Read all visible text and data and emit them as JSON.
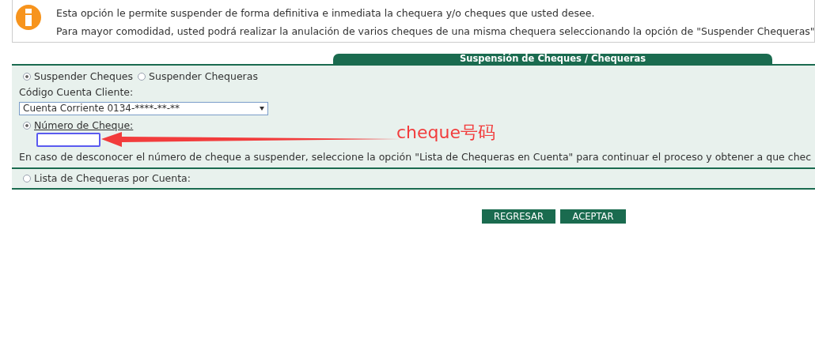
{
  "info": {
    "lines": [
      "Esta opción le permite suspender de forma definitiva e inmediata la chequera y/o cheques que usted desee.",
      "Para mayor comodidad, usted podrá realizar la anulación de varios cheques de una misma chequera seleccionando la opción de \"Suspender Chequeras\""
    ]
  },
  "panel": {
    "title": "Suspensión de Cheques / Chequeras",
    "modes": [
      {
        "label": "Suspender Cheques",
        "selected": true
      },
      {
        "label": "Suspender Chequeras",
        "selected": false
      }
    ],
    "account_label": "Código Cuenta Cliente:",
    "account_value": "Cuenta Corriente 0134-****-**-**",
    "cheque_option": {
      "label": "Número de Cheque:",
      "selected": true
    },
    "help": "En caso de desconocer el número de cheque a suspender, seleccione la opción \"Lista de Chequeras en Cuenta\" para continuar el proceso y obtener a que chec",
    "list_option": {
      "label": "Lista de Chequeras por Cuenta:",
      "selected": false
    }
  },
  "buttons": [
    "REGRESAR",
    "ACEPTAR"
  ],
  "annotation": {
    "text": "cheque号码"
  }
}
